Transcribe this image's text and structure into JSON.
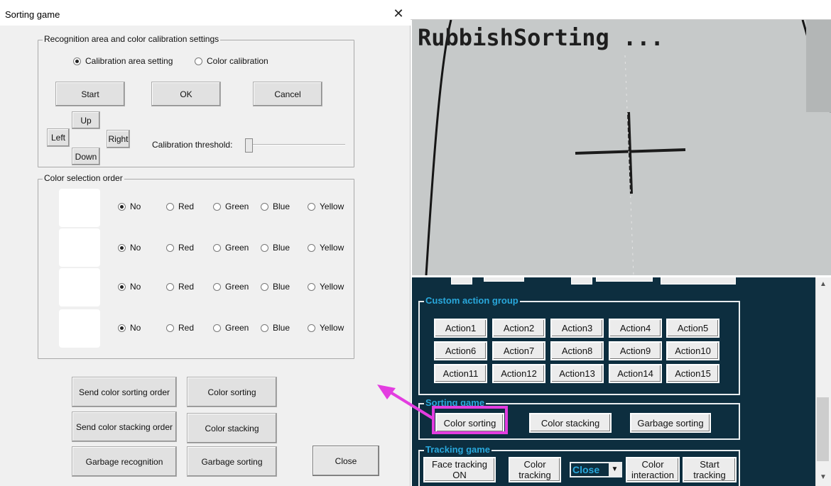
{
  "dialog": {
    "title": "Sorting game",
    "close_glyph": "✕",
    "calibration_group": {
      "label": "Recognition area and color calibration settings",
      "radio_area": "Calibration area setting",
      "radio_color": "Color calibration",
      "start": "Start",
      "ok": "OK",
      "cancel": "Cancel",
      "up": "Up",
      "left": "Left",
      "right": "Right",
      "down": "Down",
      "threshold_label": "Calibration threshold:"
    },
    "color_order_group": {
      "label": "Color selection order",
      "options": [
        "No",
        "Red",
        "Green",
        "Blue",
        "Yellow"
      ]
    },
    "buttons": {
      "send_sorting": "Send color sorting order",
      "color_sorting": "Color sorting",
      "send_stacking": "Send color stacking order",
      "color_stacking": "Color stacking",
      "garbage_recognition": "Garbage recognition",
      "garbage_sorting": "Garbage sorting",
      "close": "Close"
    }
  },
  "camera": {
    "overlay_text": "RubbishSorting ..."
  },
  "panel": {
    "custom_group_label": "Custom action group",
    "actions": [
      "Action1",
      "Action2",
      "Action3",
      "Action4",
      "Action5",
      "Action6",
      "Action7",
      "Action8",
      "Action9",
      "Action10",
      "Action11",
      "Action12",
      "Action13",
      "Action14",
      "Action15"
    ],
    "sorting_group_label": "Sorting game",
    "color_sorting": "Color sorting",
    "color_stacking": "Color stacking",
    "garbage_sorting": "Garbage sorting",
    "tracking_group_label": "Tracking game",
    "face_tracking": "Face tracking ON",
    "color_tracking": "Color tracking",
    "select_value": "Close",
    "color_interaction": "Color interaction",
    "start_tracking": "Start tracking"
  },
  "colors": {
    "highlight": "#e33de0",
    "panel_bg": "#0d2e3f",
    "panel_label": "#29a8dc"
  }
}
